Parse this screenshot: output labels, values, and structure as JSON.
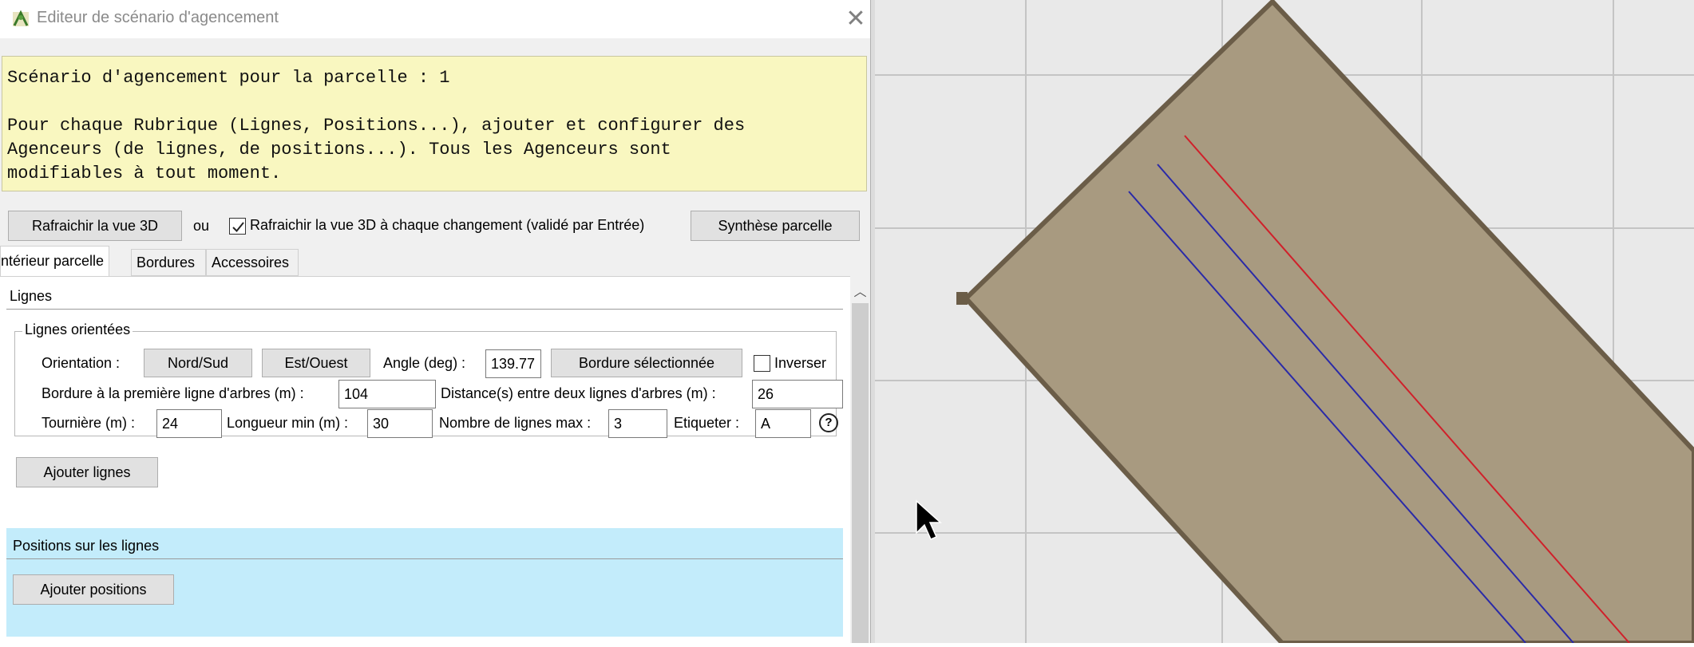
{
  "window": {
    "title": "Editeur de scénario d'agencement",
    "close_glyph": "✕"
  },
  "info": {
    "line1": "Scénario d'agencement pour la parcelle : 1",
    "line2": "Pour chaque Rubrique (Lignes, Positions...), ajouter et configurer des",
    "line3": "Agenceurs (de lignes, de positions...). Tous les Agenceurs sont",
    "line4": "modifiables à tout moment."
  },
  "toolbar": {
    "refresh_button": "Rafraichir la vue 3D",
    "or_label": "ou",
    "auto_refresh_checked": true,
    "auto_refresh_label": "Rafraichir la vue 3D à chaque changement (validé par Entrée)",
    "summary_button": "Synthèse parcelle"
  },
  "tabs": [
    {
      "label": "ntérieur parcelle",
      "active": true
    },
    {
      "label": "Bordures",
      "active": false
    },
    {
      "label": "Accessoires",
      "active": false
    }
  ],
  "lignes": {
    "section_title": "Lignes",
    "group_title": "Lignes orientées",
    "orientation_label": "Orientation :",
    "north_south_button": "Nord/Sud",
    "east_west_button": "Est/Ouest",
    "angle_label": "Angle (deg) :",
    "angle_value": "139.77",
    "selected_border_button": "Bordure sélectionnée",
    "invert_label": "Inverser",
    "invert_checked": false,
    "border_first_line_label": "Bordure à la première ligne d'arbres (m) :",
    "border_first_line_value": "104",
    "distance_label": "Distance(s) entre deux lignes d'arbres (m) :",
    "distance_value": "26",
    "headland_label": "Tournière (m) :",
    "headland_value": "24",
    "min_length_label": "Longueur min (m) :",
    "min_length_value": "30",
    "max_lines_label": "Nombre de lignes max :",
    "max_lines_value": "3",
    "tag_label": "Etiqueter :",
    "tag_value": "A",
    "help_glyph": "?",
    "add_lines_button": "Ajouter lignes"
  },
  "positions": {
    "section_title": "Positions sur les lignes",
    "add_positions_button": "Ajouter positions"
  },
  "colors": {
    "info_bg": "#f9f7c0",
    "positions_bg": "#c3ecfb",
    "parcel_fill": "#a89a80",
    "parcel_border": "#6b5d48",
    "line_red": "#d0202a",
    "line_blue": "#2a2aa8",
    "view_bg": "#e9e9e9",
    "grid": "#c4c4c4"
  }
}
